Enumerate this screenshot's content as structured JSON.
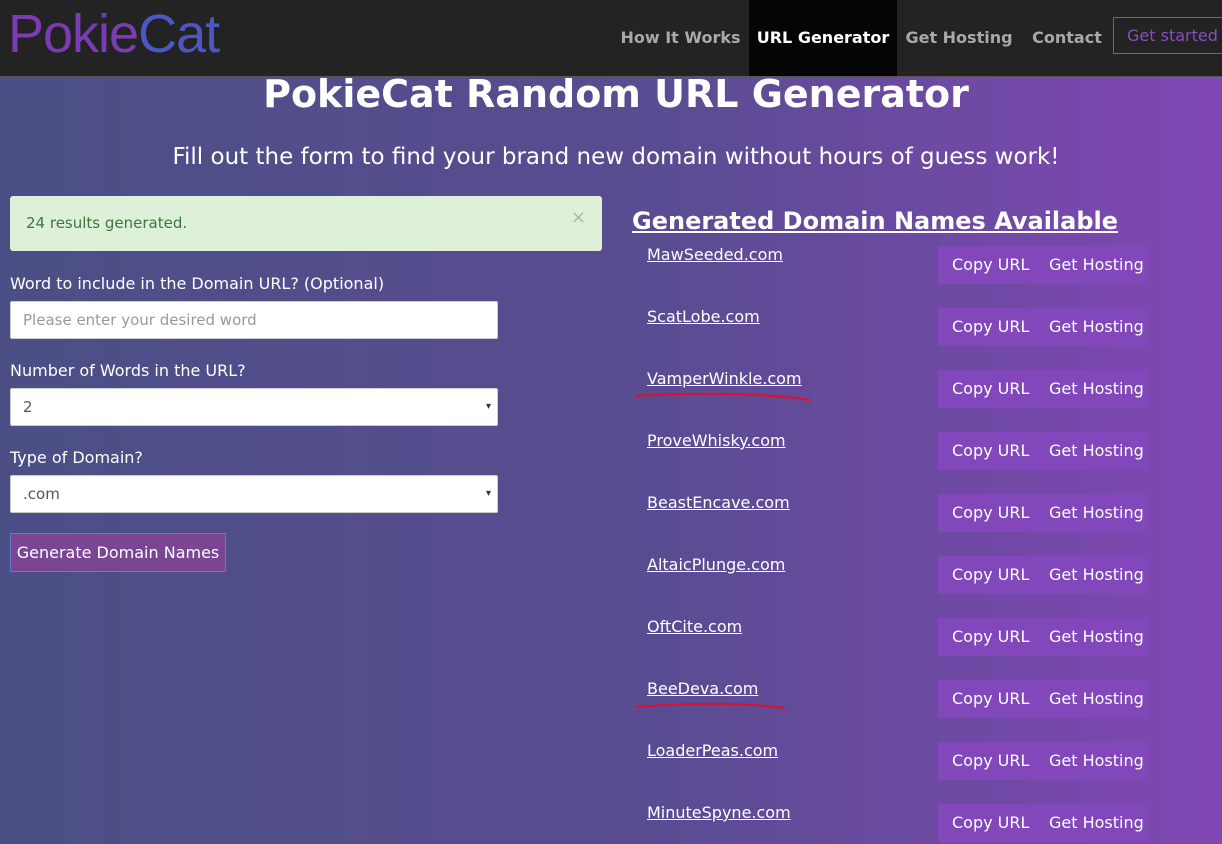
{
  "header": {
    "logo_part1": "Pokie",
    "logo_part2": "Cat",
    "nav": [
      "How It Works",
      "URL Generator",
      "Get Hosting",
      "Contact"
    ],
    "cta": "Get started"
  },
  "hero": {
    "title": "PokieCat Random URL Generator",
    "subtitle": "Fill out the form to find your brand new domain without hours of guess work!"
  },
  "alert": {
    "message": "24 results generated.",
    "close": "×"
  },
  "form": {
    "word_label": "Word to include in the Domain URL? (Optional)",
    "word_placeholder": "Please enter your desired word",
    "count_label": "Number of Words in the URL?",
    "count_value": "2",
    "type_label": "Type of Domain?",
    "type_value": ".com",
    "submit": "Generate Domain Names",
    "caret": "▾"
  },
  "results": {
    "title": "Generated Domain Names Available",
    "copy_label": "Copy URL",
    "host_label": "Get Hosting",
    "items": [
      "MawSeeded.com",
      "ScatLobe.com",
      "VamperWinkle.com",
      "ProveWhisky.com",
      "BeastEncave.com",
      "AltaicPlunge.com",
      "OftCite.com",
      "BeeDeva.com",
      "LoaderPeas.com",
      "MinuteSpyne.com"
    ]
  },
  "colors": {
    "annotation": "#e0102a",
    "accent": "#8247ba"
  }
}
